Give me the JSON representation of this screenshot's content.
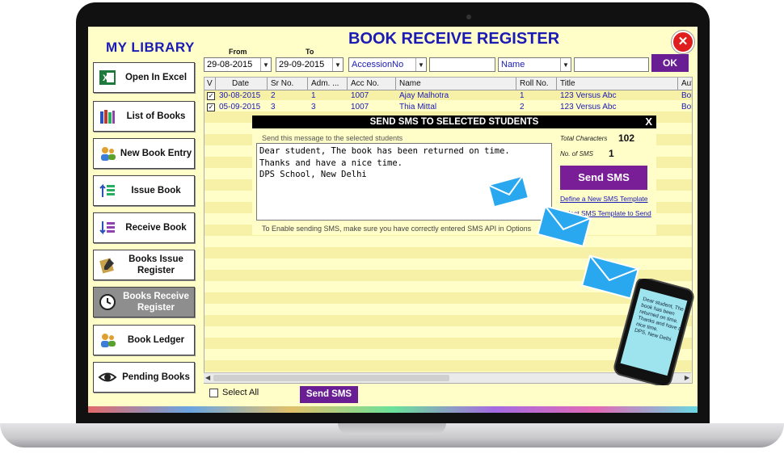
{
  "app": {
    "brand": "MY LIBRARY",
    "title": "BOOK RECEIVE REGISTER",
    "close_symbol": "✕"
  },
  "sidebar": {
    "items": [
      {
        "label": "Open In Excel",
        "icon": "excel-icon"
      },
      {
        "label": "List of Books",
        "icon": "books-icon"
      },
      {
        "label": "New Book Entry",
        "icon": "users-icon"
      },
      {
        "label": "Issue Book",
        "icon": "issue-icon"
      },
      {
        "label": "Receive Book",
        "icon": "receive-icon"
      },
      {
        "label_line1": "Books Issue",
        "label_line2": "Register",
        "icon": "register-icon"
      },
      {
        "label_line1": "Books Receive",
        "label_line2": "Register",
        "icon": "clock-icon",
        "active": true
      },
      {
        "label": "Book Ledger",
        "icon": "ledger-icon"
      },
      {
        "label": "Pending Books",
        "icon": "eye-icon"
      }
    ]
  },
  "filters": {
    "from_label": "From",
    "to_label": "To",
    "from_date": "29-08-2015",
    "to_date": "29-09-2015",
    "field1": "AccessionNo",
    "field2": "Name",
    "ok_label": "OK"
  },
  "grid": {
    "columns": [
      "V",
      "Date",
      "Sr No.",
      "Adm. ...",
      "Acc No.",
      "Name",
      "Roll No.",
      "Title",
      "Aut"
    ],
    "rows": [
      {
        "checked": "✓",
        "date": "30-08-2015",
        "sr": "2",
        "adm": "1",
        "acc": "1007",
        "name": "Ajay Malhotra",
        "roll": "1",
        "title": "123 Versus Abc",
        "author": "Bol"
      },
      {
        "checked": "✓",
        "date": "05-09-2015",
        "sr": "3",
        "adm": "3",
        "acc": "1007",
        "name": "Thia Mittal",
        "roll": "2",
        "title": "123 Versus Abc",
        "author": "Bol"
      }
    ]
  },
  "footer": {
    "select_all": "Select All",
    "send_sms": "Send SMS"
  },
  "sms": {
    "header": "SEND SMS TO SELECTED STUDENTS",
    "close": "X",
    "caption": "Send this message to the selected students",
    "message": [
      "Dear student, The book has been returned on time.",
      "Thanks and have a nice time.",
      "DPS School, New Delhi"
    ],
    "note": "To Enable sending SMS, make sure you have correctly entered SMS API in Options",
    "total_chars_label": "Total Characters",
    "total_chars": "102",
    "num_sms_label": "No. of SMS",
    "num_sms": "1",
    "send_label": "Send SMS",
    "link_define": "Define a New SMS Template",
    "link_select": "Select SMS Template to Send"
  },
  "phone": {
    "message": [
      "Dear student, The",
      "book has been",
      "returned on time.",
      "Thanks and have a",
      "nice time.",
      "DPS, New Delhi"
    ]
  }
}
